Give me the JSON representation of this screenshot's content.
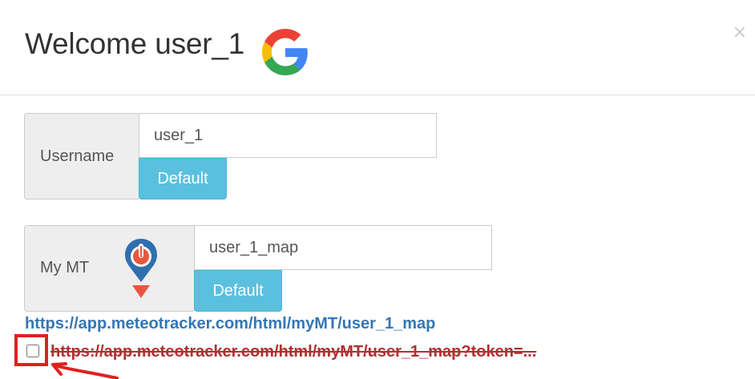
{
  "modal": {
    "title": "Welcome user_1",
    "close_glyph": "×",
    "title_icon": "google-icon"
  },
  "username_group": {
    "label": "Username",
    "value": "user_1",
    "default_label": "Default"
  },
  "my_mt_group": {
    "label": "My MT",
    "icon": "meteotracker-pin-icon",
    "value": "user_1_map",
    "default_label": "Default"
  },
  "links": {
    "public_url": "https://app.meteotracker.com/html/myMT/user_1_map",
    "token_url": "https://app.meteotracker.com/html/myMT/user_1_map?token=...",
    "token_checked": false
  },
  "colors": {
    "accent_button": "#5bc0de",
    "link": "#3476b6",
    "token_link": "#b03030",
    "highlight": "#e02020"
  }
}
